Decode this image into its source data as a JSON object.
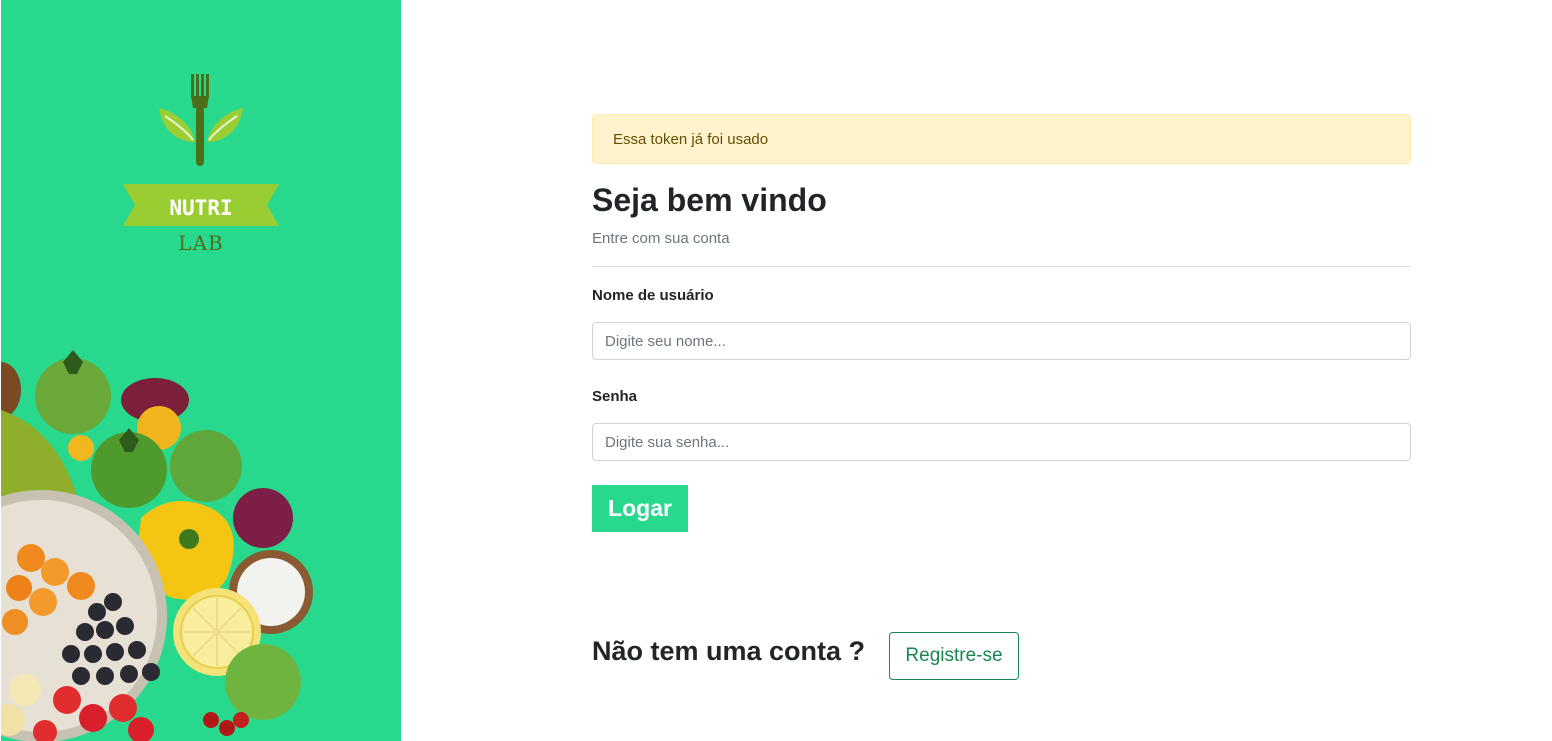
{
  "sidebar": {
    "logo": {
      "word": "NUTRI",
      "sub": "LAB"
    }
  },
  "alert": {
    "message": "Essa token já foi usado"
  },
  "login": {
    "title": "Seja bem vindo",
    "subtitle": "Entre com sua conta",
    "username_label": "Nome de usuário",
    "username_placeholder": "Digite seu nome...",
    "password_label": "Senha",
    "password_placeholder": "Digite sua senha...",
    "submit_label": "Logar"
  },
  "register": {
    "prompt": "Não tem uma conta ?",
    "button_label": "Registre-se"
  },
  "colors": {
    "brand": "#28d98d",
    "logo_green": "#9acd32",
    "fork": "#4e6f1a",
    "alert_bg": "#fff3cd",
    "register": "#198754"
  }
}
